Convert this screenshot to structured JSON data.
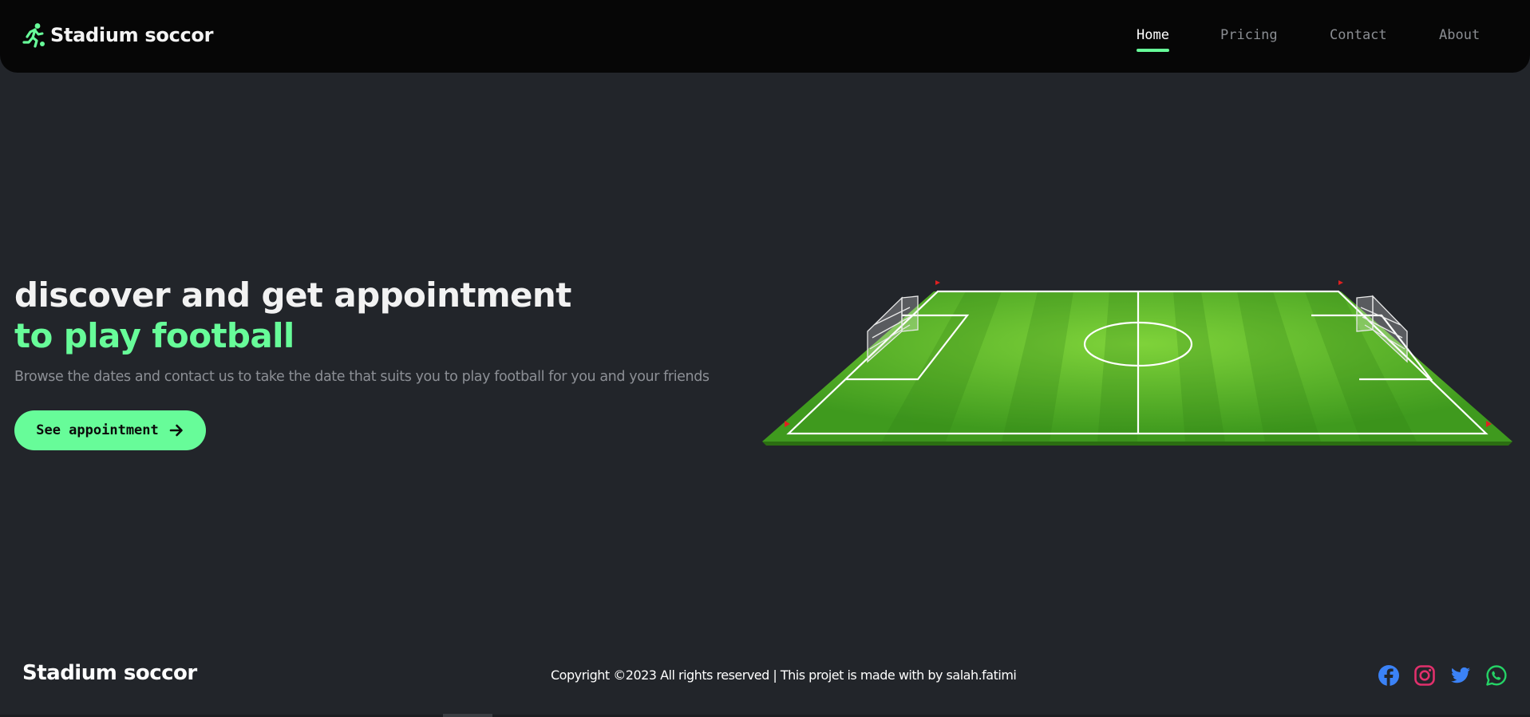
{
  "brand": {
    "name": "Stadium soccor",
    "icon": "runner-icon",
    "accent_color": "#67fc99"
  },
  "nav": {
    "items": [
      {
        "label": "Home",
        "active": true
      },
      {
        "label": "Pricing",
        "active": false
      },
      {
        "label": "Contact",
        "active": false
      },
      {
        "label": "About",
        "active": false
      }
    ]
  },
  "hero": {
    "title_line1": "discover and get appointment",
    "title_line2": "to play football",
    "description": "Browse the dates and contact us to take the date that suits you to play football for you and your friends",
    "cta_label": "See appointment",
    "cta_icon": "arrow-right-icon",
    "image": "soccer-pitch-illustration"
  },
  "footer": {
    "brand": "Stadium soccor",
    "copyright": "Copyright ©2023 All rights reserved | This projet is made with by salah.fatimi",
    "social": [
      {
        "name": "facebook-icon",
        "color": "#3b82f6"
      },
      {
        "name": "instagram-icon",
        "color": "#e1306c"
      },
      {
        "name": "twitter-icon",
        "color": "#3b82f6"
      },
      {
        "name": "whatsapp-icon",
        "color": "#25d366"
      }
    ]
  }
}
